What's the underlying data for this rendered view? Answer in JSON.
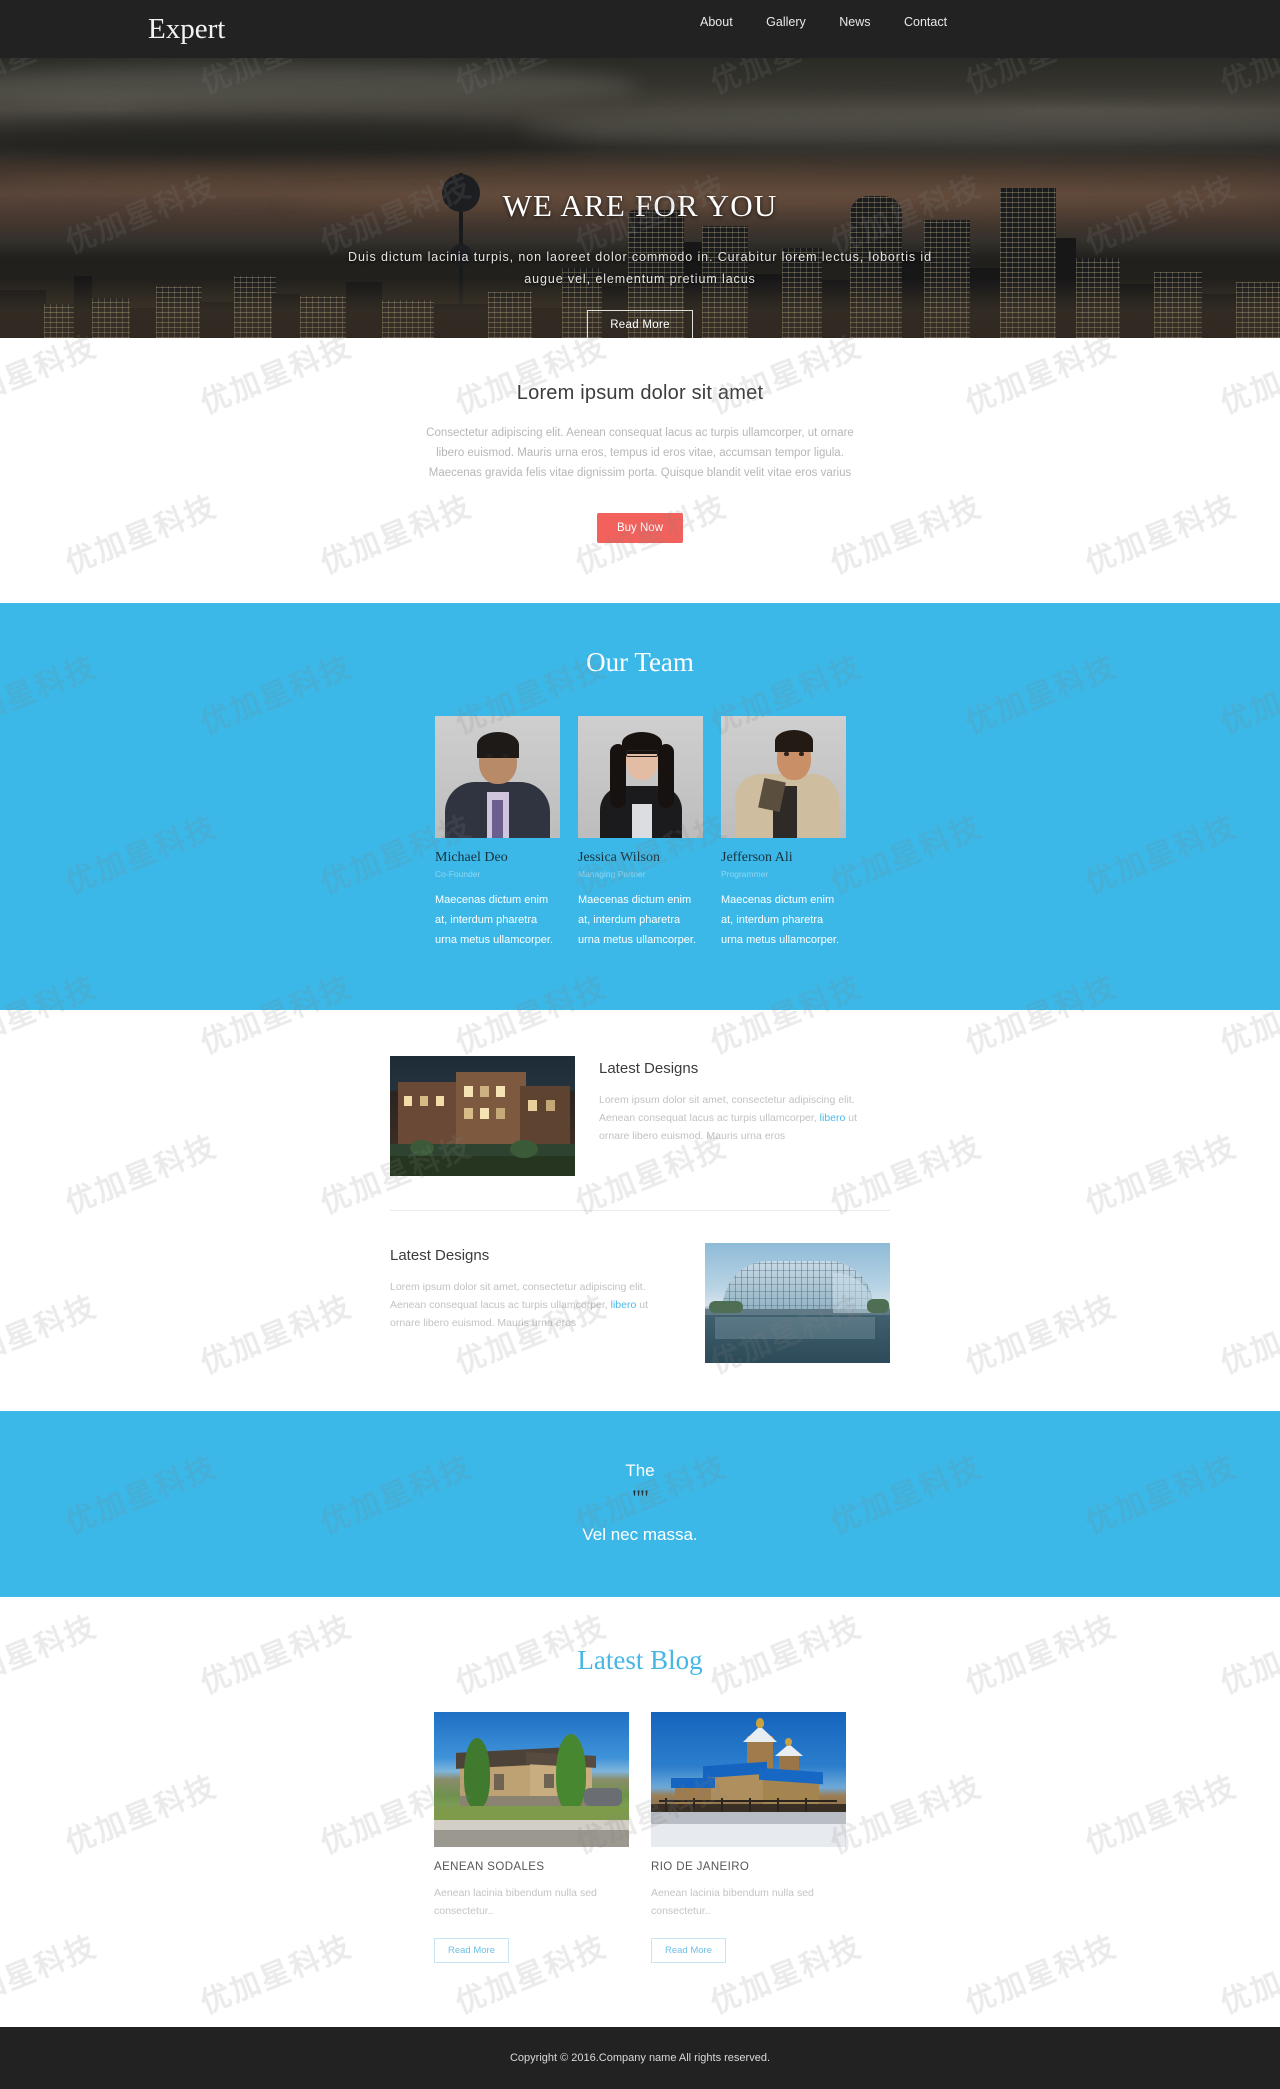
{
  "header": {
    "logo": "Expert",
    "nav": [
      {
        "label": "About"
      },
      {
        "label": "Gallery"
      },
      {
        "label": "News"
      },
      {
        "label": "Contact"
      }
    ]
  },
  "hero": {
    "title": "WE ARE FOR YOU",
    "subtitle": "Duis dictum lacinia turpis, non laoreet dolor commodo in. Curabitur lorem lectus, lobortis id augue vel, elementum pretium lacus",
    "button": "Read More",
    "image_alt": "night-city-skyline"
  },
  "intro": {
    "heading": "Lorem ipsum dolor sit amet",
    "paragraph": "Consectetur adipiscing elit. Aenean consequat lacus ac turpis ullamcorper, ut ornare libero euismod. Mauris urna eros, tempus id eros vitae, accumsan tempor ligula. Maecenas gravida felis vitae dignissim porta. Quisque blandit velit vitae eros varius",
    "button": "Buy Now",
    "button_color": "#f2615c"
  },
  "team": {
    "heading": "Our Team",
    "background_color": "#3bb8e8",
    "members": [
      {
        "name": "Michael Deo",
        "role": "Co-Founder",
        "description": "Maecenas dictum enim at, interdum pharetra urna metus ullamcorper.",
        "photo_alt": "portrait-man-suit"
      },
      {
        "name": "Jessica Wilson",
        "role": "Managing Partner",
        "description": "Maecenas dictum enim at, interdum pharetra urna metus ullamcorper.",
        "photo_alt": "portrait-woman-glasses"
      },
      {
        "name": "Jefferson Ali",
        "role": "Programmer",
        "description": "Maecenas dictum enim at, interdum pharetra urna metus ullamcorper.",
        "photo_alt": "portrait-man-coat"
      }
    ]
  },
  "designs": {
    "items": [
      {
        "title": "Latest Designs",
        "text_before_link": "Lorem ipsum dolor sit amet, consectetur adipiscing elit. Aenean consequat lacus ac turpis ullamcorper, ",
        "link": "libero",
        "text_after_link": " ut ornare libero euismod. Mauris urna eros",
        "link_color": "#4db8e8",
        "image_alt": "brick-office-building-night"
      },
      {
        "title": "Latest Designs",
        "text_before_link": "Lorem ipsum dolor sit amet, consectetur adipiscing elit. Aenean consequat lacus ac turpis ullamcorper, ",
        "link": "libero",
        "text_after_link": " ut ornare libero euismod. Mauris urna eros",
        "link_color": "#4db8e8",
        "image_alt": "modern-glass-building-waterfront"
      }
    ]
  },
  "quote": {
    "line1": "The",
    "mark": "\"\"",
    "line2": "Vel nec massa.",
    "background_color": "#3bb8e8"
  },
  "blog": {
    "heading": "Latest Blog",
    "heading_color": "#46b7e4",
    "posts": [
      {
        "title": "AENEAN SODALES",
        "excerpt": "Aenean lacinia bibendum nulla sed consectetur..",
        "button": "Read More",
        "image_alt": "suburban-house-with-trees"
      },
      {
        "title": "RIO DE JANEIRO",
        "excerpt": "Aenean lacinia bibendum nulla sed consectetur..",
        "button": "Read More",
        "image_alt": "blue-roofed-church"
      }
    ]
  },
  "footer": {
    "copyright": "Copyright © 2016.Company name All rights reserved."
  },
  "watermark": {
    "text": "优加星科技"
  }
}
